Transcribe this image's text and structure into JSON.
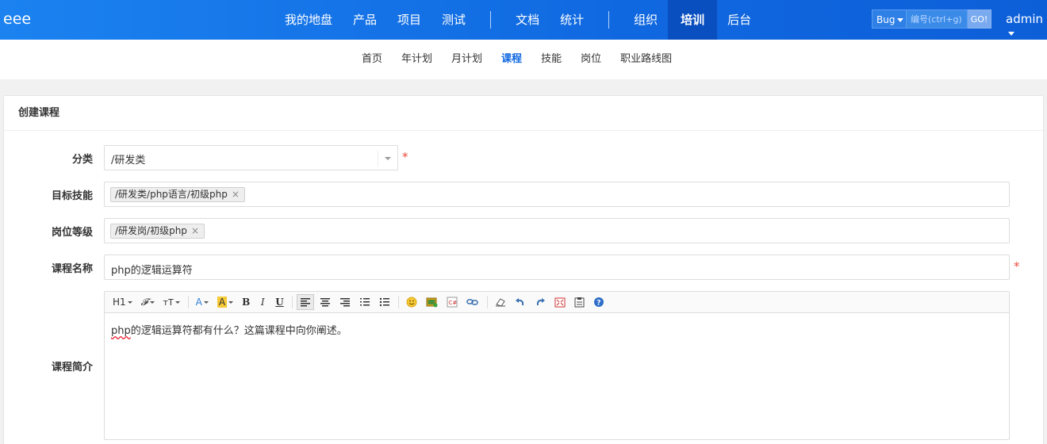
{
  "brand": "eee",
  "mainnav": {
    "group1": [
      "我的地盘",
      "产品",
      "项目",
      "测试"
    ],
    "group2": [
      "文档",
      "统计"
    ],
    "group3": [
      "组织",
      "培训",
      "后台"
    ],
    "active": "培训"
  },
  "search": {
    "type": "Bug",
    "placeholder": "编号(ctrl+g)",
    "go": "GO!"
  },
  "user": "admin",
  "subnav": {
    "items": [
      "首页",
      "年计划",
      "月计划",
      "课程",
      "技能",
      "岗位",
      "职业路线图"
    ],
    "active": "课程"
  },
  "panel": {
    "title": "创建课程"
  },
  "form": {
    "category": {
      "label": "分类",
      "value": "/研发类",
      "required": "*"
    },
    "skill": {
      "label": "目标技能",
      "chip": "/研发类/php语言/初级php",
      "remove": "×"
    },
    "post": {
      "label": "岗位等级",
      "chip": "/研发岗/初级php",
      "remove": "×"
    },
    "name": {
      "label": "课程名称",
      "value": "php的逻辑运算符",
      "required": "*"
    },
    "intro": {
      "label": "课程简介",
      "content_spell": "php",
      "content_rest": "的逻辑运算符都有什么？这篇课程中向你阐述。"
    }
  },
  "toolbar": {
    "heading": "H1",
    "font": "𝓕",
    "size": "тT",
    "color": "A",
    "bg": "A",
    "bold": "B",
    "italic": "I",
    "underline": "U"
  },
  "colors": {
    "nav_bg": "#1068e0",
    "active_nav": "#0a4fbf",
    "required": "#e84c3d",
    "highlight": "#f6c935"
  }
}
